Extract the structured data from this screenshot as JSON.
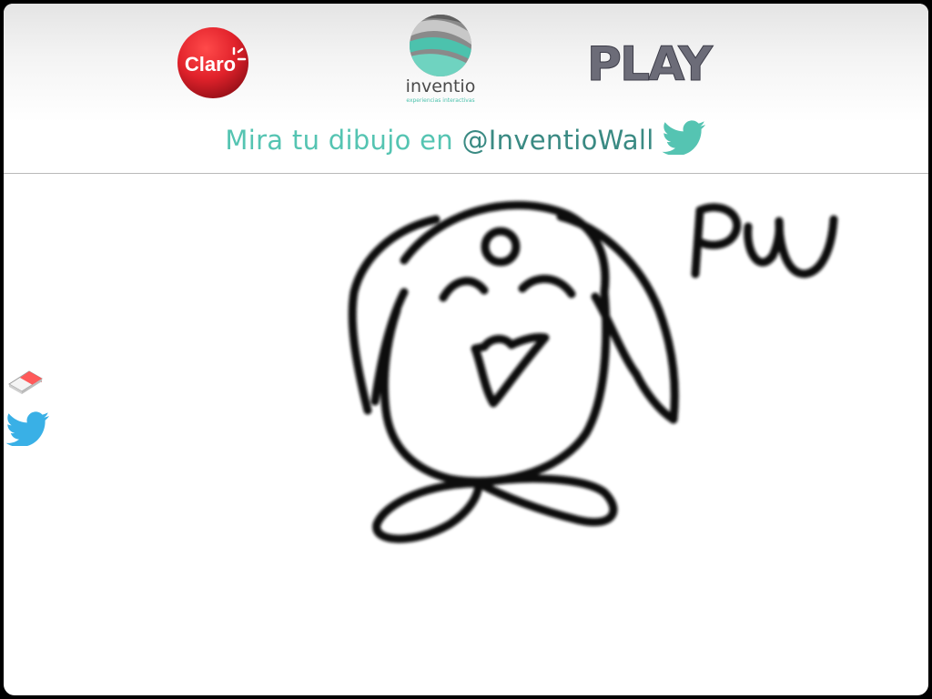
{
  "header": {
    "logos": {
      "claro": "Claro",
      "inventio_name": "inventio",
      "inventio_sub": "experiencias interactivas",
      "play": "PLAY"
    },
    "tagline_prefix": "Mira tu dibujo en ",
    "tagline_handle": "@InventioWall"
  },
  "toolbar": {
    "eraser_icon": "eraser-icon",
    "twitter_icon": "twitter-icon"
  },
  "canvas": {
    "drawn_text": "PUU"
  },
  "colors": {
    "teal": "#55c4b2",
    "teal_dark": "#3a8a83",
    "claro_red": "#e1222b",
    "twitter_blue": "#39b0e6"
  }
}
